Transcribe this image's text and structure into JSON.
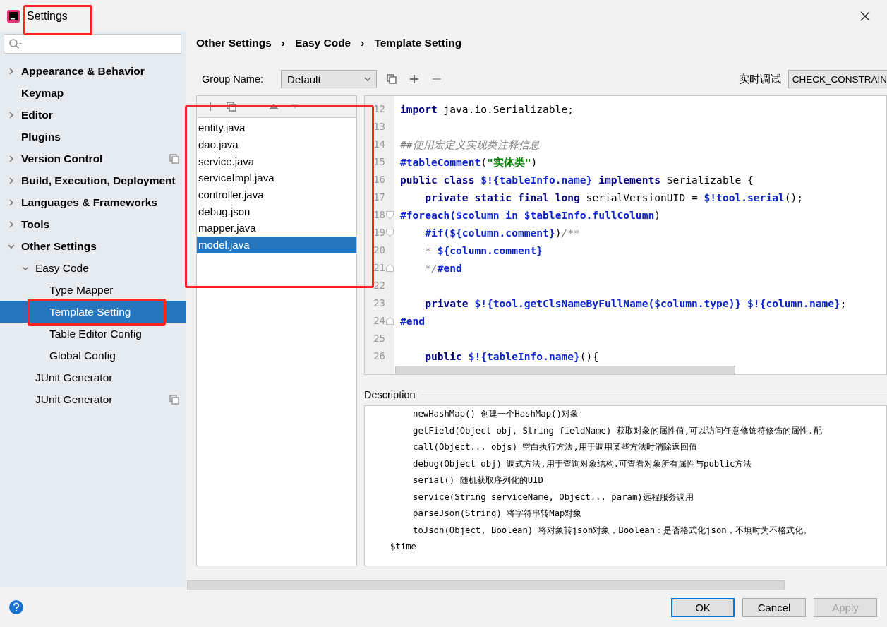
{
  "window": {
    "title": "Settings"
  },
  "sidebar": {
    "items": [
      {
        "label": "Appearance & Behavior",
        "expandable": true,
        "expanded": false,
        "selected": false,
        "project_scoped": false
      },
      {
        "label": "Keymap",
        "expandable": false,
        "selected": false,
        "project_scoped": false
      },
      {
        "label": "Editor",
        "expandable": true,
        "expanded": false,
        "selected": false,
        "project_scoped": false
      },
      {
        "label": "Plugins",
        "expandable": false,
        "selected": false,
        "project_scoped": false
      },
      {
        "label": "Version Control",
        "expandable": true,
        "expanded": false,
        "selected": false,
        "project_scoped": true
      },
      {
        "label": "Build, Execution, Deployment",
        "expandable": true,
        "expanded": false,
        "selected": false,
        "project_scoped": false
      },
      {
        "label": "Languages & Frameworks",
        "expandable": true,
        "expanded": false,
        "selected": false,
        "project_scoped": false
      },
      {
        "label": "Tools",
        "expandable": true,
        "expanded": false,
        "selected": false,
        "project_scoped": false
      },
      {
        "label": "Other Settings",
        "expandable": true,
        "expanded": true,
        "selected": false,
        "project_scoped": false,
        "children": [
          {
            "label": "Easy Code",
            "expandable": true,
            "expanded": true,
            "selected": false,
            "project_scoped": false,
            "children": [
              {
                "label": "Type Mapper",
                "expandable": false,
                "selected": false,
                "project_scoped": false
              },
              {
                "label": "Template Setting",
                "expandable": false,
                "selected": true,
                "project_scoped": false
              },
              {
                "label": "Table Editor Config",
                "expandable": false,
                "selected": false,
                "project_scoped": false
              },
              {
                "label": "Global Config",
                "expandable": false,
                "selected": false,
                "project_scoped": false
              }
            ]
          },
          {
            "label": "JUnit Generator",
            "expandable": false,
            "selected": false,
            "project_scoped": false
          },
          {
            "label": "JUnit Generator",
            "expandable": false,
            "selected": false,
            "project_scoped": true
          }
        ]
      }
    ]
  },
  "breadcrumb": [
    "Other Settings",
    "Easy Code",
    "Template Setting"
  ],
  "breadcrumb_separator": "›",
  "group": {
    "label": "Group Name:",
    "value": "Default"
  },
  "debug": {
    "label": "实时调试",
    "value": "CHECK_CONSTRAIN"
  },
  "templates": [
    {
      "name": "entity.java",
      "selected": false
    },
    {
      "name": "dao.java",
      "selected": false
    },
    {
      "name": "service.java",
      "selected": false
    },
    {
      "name": "serviceImpl.java",
      "selected": false
    },
    {
      "name": "controller.java",
      "selected": false
    },
    {
      "name": "debug.json",
      "selected": false
    },
    {
      "name": "mapper.java",
      "selected": false
    },
    {
      "name": "model.java",
      "selected": true
    }
  ],
  "code": [
    {
      "number": "12",
      "fold_start": false,
      "fold_end": false,
      "tokens": [
        {
          "kind": "keyword",
          "text": "import"
        },
        {
          "kind": "plain",
          "text": " java.io.Serializable;"
        }
      ]
    },
    {
      "number": "13",
      "fold_start": false,
      "fold_end": false
    },
    {
      "number": "14",
      "fold_start": false,
      "fold_end": false,
      "tokens": [
        {
          "kind": "comment",
          "text": "##使用宏定义实现类注释信息"
        }
      ]
    },
    {
      "number": "15",
      "fold_start": false,
      "fold_end": false,
      "tokens": [
        {
          "kind": "var",
          "text": "#tableComment"
        },
        {
          "kind": "plain",
          "text": "("
        },
        {
          "kind": "string",
          "text": "\"实体类\""
        },
        {
          "kind": "plain",
          "text": ")"
        }
      ]
    },
    {
      "number": "16",
      "fold_start": false,
      "fold_end": false,
      "tokens": [
        {
          "kind": "keyword",
          "text": "public class "
        },
        {
          "kind": "var",
          "text": "$!{tableInfo.name}"
        },
        {
          "kind": "keyword",
          "text": " implements"
        },
        {
          "kind": "plain",
          "text": " Serializable {"
        }
      ]
    },
    {
      "number": "17",
      "fold_start": false,
      "fold_end": false,
      "tokens": [
        {
          "kind": "keyword",
          "text": "    private static final long"
        },
        {
          "kind": "plain",
          "text": " serialVersionUID = "
        },
        {
          "kind": "var",
          "text": "$!tool.serial"
        },
        {
          "kind": "plain",
          "text": "();"
        }
      ]
    },
    {
      "number": "18",
      "fold_start": true,
      "fold_end": false,
      "tokens": [
        {
          "kind": "var",
          "text": "#foreach($column in $tableInfo.fullColumn"
        },
        {
          "kind": "plain",
          "text": ")"
        }
      ]
    },
    {
      "number": "19",
      "fold_start": true,
      "fold_end": false,
      "tokens": [
        {
          "kind": "var",
          "text": "    #if(${column.comment}"
        },
        {
          "kind": "plain",
          "text": ")"
        },
        {
          "kind": "comment",
          "text": "/**"
        }
      ]
    },
    {
      "number": "20",
      "fold_start": false,
      "fold_end": false,
      "tokens": [
        {
          "kind": "comment",
          "text": "    * "
        },
        {
          "kind": "var",
          "text": "${column.comment}"
        }
      ]
    },
    {
      "number": "21",
      "fold_start": false,
      "fold_end": true,
      "tokens": [
        {
          "kind": "comment",
          "text": "    */"
        },
        {
          "kind": "var",
          "text": "#end"
        }
      ]
    },
    {
      "number": "22",
      "fold_start": false,
      "fold_end": false
    },
    {
      "number": "23",
      "fold_start": false,
      "fold_end": false,
      "tokens": [
        {
          "kind": "keyword",
          "text": "    private "
        },
        {
          "kind": "var",
          "text": "$!{tool.getClsNameByFullName($column.type)}"
        },
        {
          "kind": "var",
          "text": " $!{column.name}"
        },
        {
          "kind": "plain",
          "text": ";"
        }
      ]
    },
    {
      "number": "24",
      "fold_start": false,
      "fold_end": true,
      "tokens": [
        {
          "kind": "var",
          "text": "#end"
        }
      ]
    },
    {
      "number": "25",
      "fold_start": false,
      "fold_end": false
    },
    {
      "number": "26",
      "fold_start": false,
      "fold_end": false,
      "tokens": [
        {
          "kind": "keyword",
          "text": "    public "
        },
        {
          "kind": "var",
          "text": "$!{tableInfo.name}"
        },
        {
          "kind": "plain",
          "text": "(){"
        }
      ]
    }
  ],
  "description": {
    "title": "Description",
    "lines": [
      {
        "indent": true,
        "text": "newHashMap() 创建一个HashMap()对象"
      },
      {
        "indent": true,
        "text": "getField(Object obj, String fieldName) 获取对象的属性值,可以访问任意修饰符修饰的属性.配"
      },
      {
        "indent": true,
        "text": "call(Object... objs) 空白执行方法,用于调用某些方法时消除返回值"
      },
      {
        "indent": true,
        "text": "debug(Object obj) 调式方法,用于查询对象结构.可查看对象所有属性与public方法"
      },
      {
        "indent": true,
        "text": "serial() 随机获取序列化的UID"
      },
      {
        "indent": true,
        "text": "service(String serviceName, Object... param)远程服务调用"
      },
      {
        "indent": true,
        "text": "parseJson(String) 将字符串转Map对象"
      },
      {
        "indent": true,
        "text": "toJson(Object, Boolean) 将对象转json对象，Boolean：是否格式化json，不填时为不格式化。"
      },
      {
        "indent": false,
        "text": "$time"
      }
    ]
  },
  "buttons": [
    {
      "label": "OK",
      "default": true,
      "disabled": false
    },
    {
      "label": "Cancel",
      "default": false,
      "disabled": false
    },
    {
      "label": "Apply",
      "default": false,
      "disabled": true
    }
  ]
}
